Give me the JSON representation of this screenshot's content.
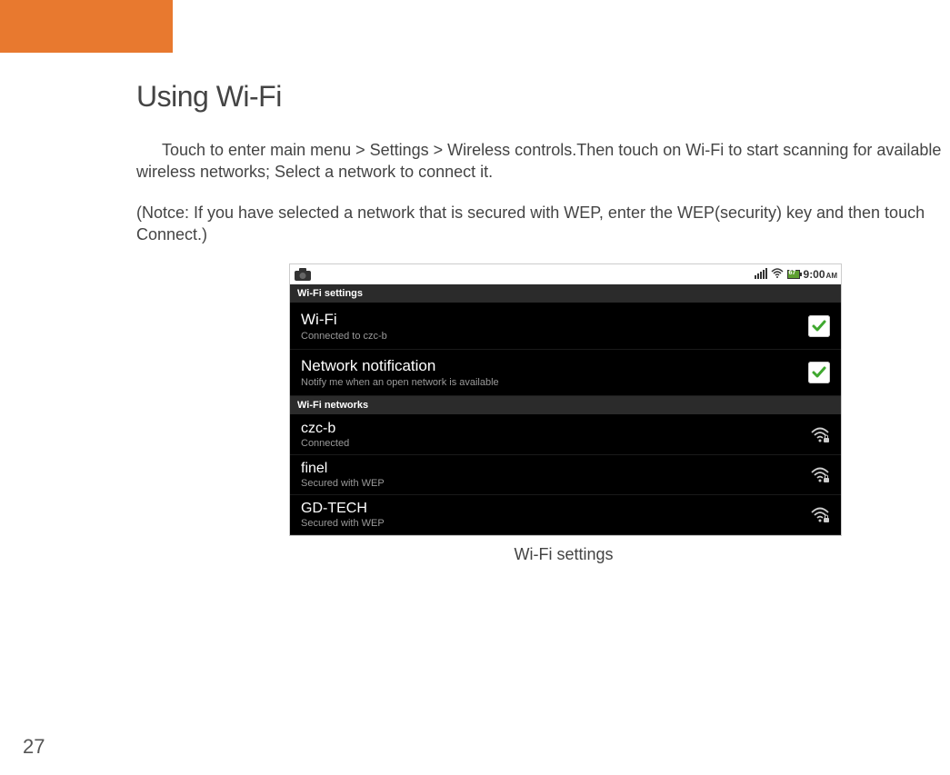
{
  "page": {
    "number": "27",
    "title": "Using Wi-Fi",
    "para1": "Touch to enter main menu > Settings > Wireless controls.Then  touch on  Wi-Fi to start scanning for available wireless networks; Select a network to connect it.",
    "para2": "(Notce: If you have selected a network that is secured with WEP, enter the WEP(security) key and then touch Connect.)",
    "caption": "Wi-Fi settings"
  },
  "screenshot": {
    "statusbar": {
      "time": "9:00",
      "ampm": "AM"
    },
    "section1": "Wi-Fi settings",
    "wifi_row": {
      "title": "Wi-Fi",
      "sub": "Connected to czc-b"
    },
    "notif_row": {
      "title": "Network notification",
      "sub": "Notify me when an open network is available"
    },
    "section2": "Wi-Fi networks",
    "networks": [
      {
        "name": "czc-b",
        "sub": "Connected"
      },
      {
        "name": "finel",
        "sub": "Secured with WEP"
      },
      {
        "name": "GD-TECH",
        "sub": "Secured with WEP"
      }
    ]
  }
}
